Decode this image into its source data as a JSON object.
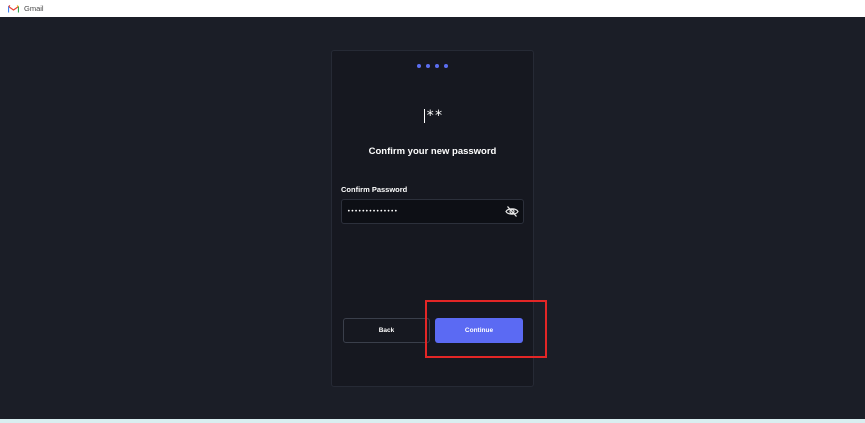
{
  "bookmarks": [
    {
      "label": "Gmail",
      "icon": "gmail-icon"
    }
  ],
  "card": {
    "step_dots": 4,
    "step_color": "#5b6ef0",
    "password_glyph": "**",
    "heading": "Confirm your new password",
    "field_label": "Confirm Password",
    "password_value": "••••••••••••••",
    "visibility_icon": "eye-slash-icon",
    "back_label": "Back",
    "continue_label": "Continue",
    "accent_color": "#5b6af3"
  },
  "annotation": {
    "highlight_color": "#e32626"
  }
}
